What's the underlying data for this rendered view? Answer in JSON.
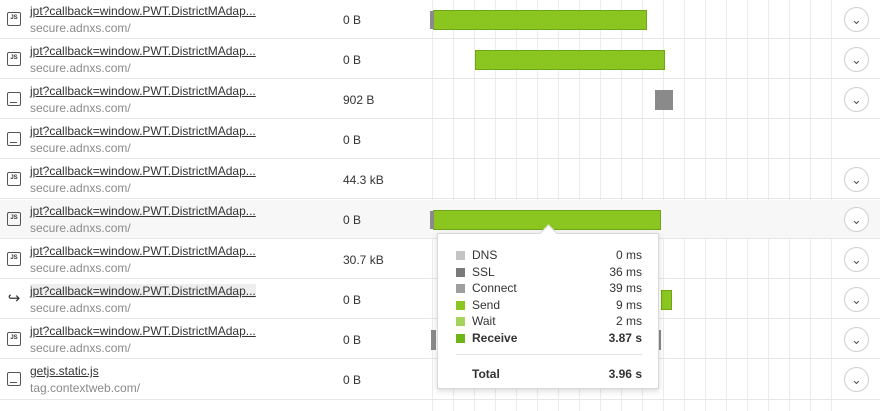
{
  "rows": [
    {
      "name": "jpt?callback=window.PWT.DistrictMAdap...",
      "domain": "secure.adnxs.com/",
      "size": "0 B",
      "icon": "JS"
    },
    {
      "name": "jpt?callback=window.PWT.DistrictMAdap...",
      "domain": "secure.adnxs.com/",
      "size": "0 B",
      "icon": "JS"
    },
    {
      "name": "jpt?callback=window.PWT.DistrictMAdap...",
      "domain": "secure.adnxs.com/",
      "size": "902 B",
      "icon": "IMG"
    },
    {
      "name": "jpt?callback=window.PWT.DistrictMAdap...",
      "domain": "secure.adnxs.com/",
      "size": "0 B",
      "icon": "IMG"
    },
    {
      "name": "jpt?callback=window.PWT.DistrictMAdap...",
      "domain": "secure.adnxs.com/",
      "size": "44.3 kB",
      "icon": "JS"
    },
    {
      "name": "jpt?callback=window.PWT.DistrictMAdap...",
      "domain": "secure.adnxs.com/",
      "size": "0 B",
      "icon": "JS"
    },
    {
      "name": "jpt?callback=window.PWT.DistrictMAdap...",
      "domain": "secure.adnxs.com/",
      "size": "30.7 kB",
      "icon": "JS"
    },
    {
      "name": "jpt?callback=window.PWT.DistrictMAdap...",
      "domain": "secure.adnxs.com/",
      "size": "0 B",
      "icon": "REDIRECT"
    },
    {
      "name": "jpt?callback=window.PWT.DistrictMAdap...",
      "domain": "secure.adnxs.com/",
      "size": "0 B",
      "icon": "JS"
    },
    {
      "name": "getjs.static.js",
      "domain": "tag.contextweb.com/",
      "size": "0 B",
      "icon": "IMG"
    }
  ],
  "icons": {
    "js": "js-file-icon",
    "img": "image-file-icon",
    "redirect": "redirect-arrow-icon",
    "chevron": "chevron-down-icon"
  },
  "tooltip": {
    "items": [
      {
        "label": "DNS",
        "value": "0 ms",
        "color": "#c4c4c4"
      },
      {
        "label": "SSL",
        "value": "36 ms",
        "color": "#7a7a7a"
      },
      {
        "label": "Connect",
        "value": "39 ms",
        "color": "#9e9e9e"
      },
      {
        "label": "Send",
        "value": "9 ms",
        "color": "#8bc620"
      },
      {
        "label": "Wait",
        "value": "2 ms",
        "color": "#a6d45a"
      },
      {
        "label": "Receive",
        "value": "3.87 s",
        "color": "#6fb51a"
      }
    ],
    "total_label": "Total",
    "total_value": "3.96 s"
  },
  "colors": {
    "bar": "#8bc620",
    "bar_border": "#6fa516",
    "queue": "#8a8a8a"
  }
}
